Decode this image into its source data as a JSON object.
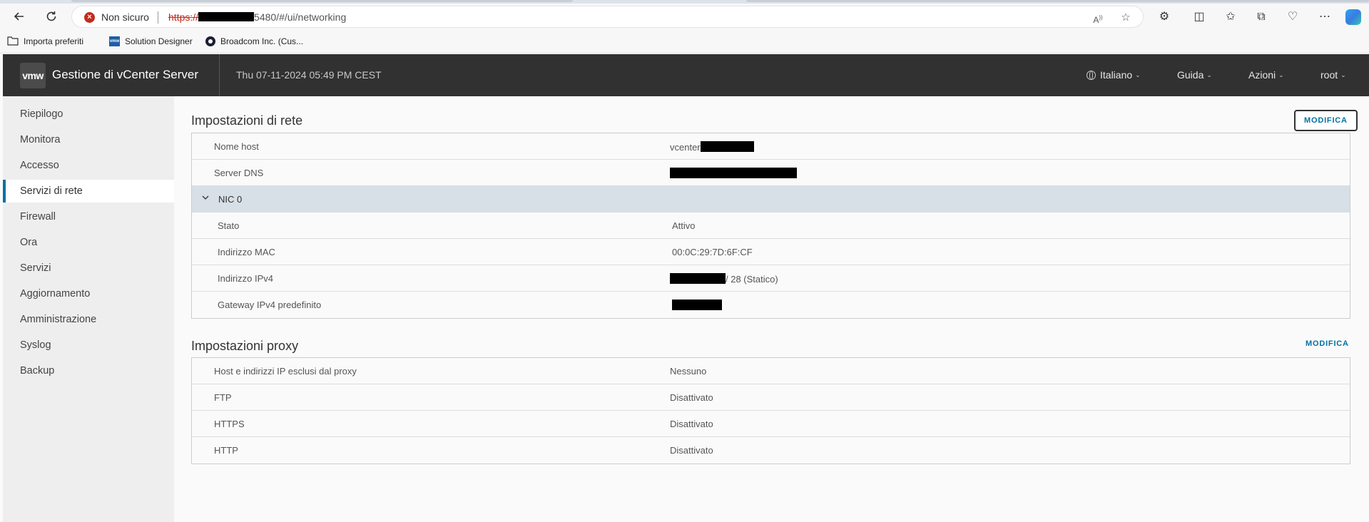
{
  "browser": {
    "security_label": "Non sicuro",
    "url_scheme": "https://",
    "url_rest": "5480/#/ui/networking",
    "bookmarks": [
      "Importa preferiti",
      "Solution Designer",
      "Broadcom Inc. (Cus..."
    ],
    "bookmark_icon_label": "vmw"
  },
  "header": {
    "logo": "vmw",
    "title": "Gestione di vCenter Server",
    "datetime": "Thu 07-11-2024 05:49 PM CEST",
    "language": "Italiano",
    "help": "Guida",
    "actions": "Azioni",
    "user": "root"
  },
  "sidebar": {
    "items": [
      {
        "label": "Riepilogo"
      },
      {
        "label": "Monitora"
      },
      {
        "label": "Accesso"
      },
      {
        "label": "Servizi di rete",
        "active": true
      },
      {
        "label": "Firewall"
      },
      {
        "label": "Ora"
      },
      {
        "label": "Servizi"
      },
      {
        "label": "Aggiornamento"
      },
      {
        "label": "Amministrazione"
      },
      {
        "label": "Syslog"
      },
      {
        "label": "Backup"
      }
    ]
  },
  "network": {
    "title": "Impostazioni di rete",
    "edit_label": "MODIFICA",
    "hostname_key": "Nome host",
    "hostname_value": "vcenter",
    "dns_key": "Server DNS",
    "nic_label": "NIC 0",
    "state_key": "Stato",
    "state_value": "Attivo",
    "mac_key": "Indirizzo MAC",
    "mac_value": "00:0C:29:7D:6F:CF",
    "ipv4_key": "Indirizzo IPv4",
    "ipv4_suffix": "/ 28 (Statico)",
    "gateway_key": "Gateway IPv4 predefinito"
  },
  "proxy": {
    "title": "Impostazioni proxy",
    "edit_label": "MODIFICA",
    "rows": [
      {
        "key": "Host e indirizzi IP esclusi dal proxy",
        "value": "Nessuno"
      },
      {
        "key": "FTP",
        "value": "Disattivato"
      },
      {
        "key": "HTTPS",
        "value": "Disattivato"
      },
      {
        "key": "HTTP",
        "value": "Disattivato"
      }
    ]
  },
  "colors": {
    "header_bg": "#313131",
    "accent": "#0072a3",
    "group_row_bg": "#d7e0e6",
    "sidebar_bg": "#eeeeee"
  }
}
